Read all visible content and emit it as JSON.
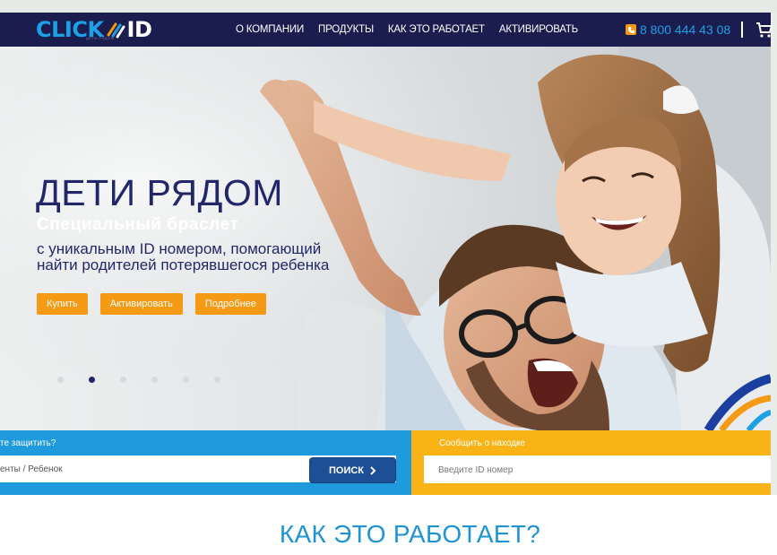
{
  "header": {
    "logo": {
      "part1": "CLICK",
      "part2": "ID",
      "tagline": "ДЕТИ РЯДОМ"
    },
    "nav": [
      {
        "label": "О КОМПАНИИ"
      },
      {
        "label": "ПРОДУКТЫ"
      },
      {
        "label": "КАК ЭТО РАБОТАЕТ"
      },
      {
        "label": "АКТИВИРОВАТЬ"
      }
    ],
    "phone": "8 800 444 43 08",
    "divider": "|"
  },
  "hero": {
    "title": "ДЕТИ РЯДОМ",
    "subtitle": "Специальный браслет",
    "description_line1": "с уникальным ID номером, помогающий",
    "description_line2": "найти родителей потерявшегося ребенка",
    "buttons": {
      "buy": "Купить",
      "activate": "Активировать",
      "more": "Подробнее"
    },
    "active_slide": 2,
    "slide_count": 6
  },
  "search": {
    "left_label": "те защитить?",
    "left_value": "енты / Ребенок",
    "search_button": "ПОИСК",
    "right_label": "Сообщить о находке",
    "right_placeholder": "Введите ID номер"
  },
  "section": {
    "title": "КАК ЭТО РАБОТАЕТ?"
  },
  "colors": {
    "header_bg": "#1a1d4e",
    "accent_blue": "#1ea0e6",
    "accent_orange": "#f59a14",
    "search_blue": "#1f9adc",
    "search_yellow": "#f9b317",
    "title_navy": "#22276a"
  }
}
